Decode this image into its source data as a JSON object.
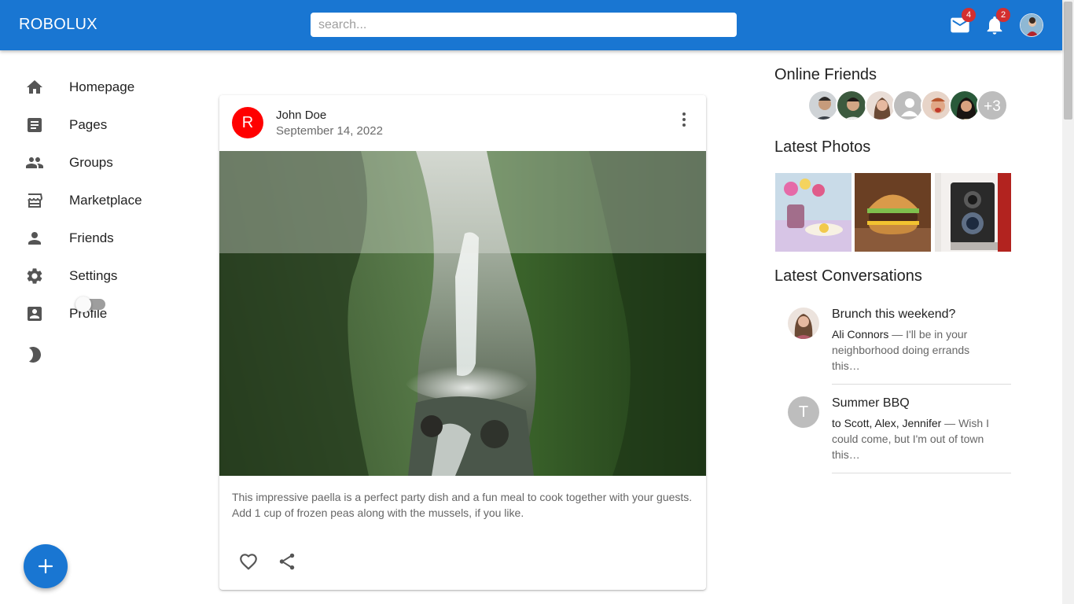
{
  "app": {
    "title": "ROBOLUX",
    "accent": "#1976d2"
  },
  "search": {
    "placeholder": "search...",
    "value": ""
  },
  "topbar": {
    "mail": {
      "icon": "mail-icon",
      "count": "4"
    },
    "notifications": {
      "icon": "bell-icon",
      "count": "2"
    },
    "avatar": {
      "icon": "user-avatar"
    }
  },
  "sidebar": {
    "items": [
      {
        "label": "Homepage",
        "icon": "home-icon"
      },
      {
        "label": "Pages",
        "icon": "article-icon"
      },
      {
        "label": "Groups",
        "icon": "group-icon"
      },
      {
        "label": "Marketplace",
        "icon": "storefront-icon"
      },
      {
        "label": "Friends",
        "icon": "person-icon"
      },
      {
        "label": "Settings",
        "icon": "gear-icon"
      },
      {
        "label": "Profile",
        "icon": "account-box-icon"
      }
    ],
    "dark_mode": {
      "icon": "moon-icon",
      "on": false
    }
  },
  "fab": {
    "icon": "plus-icon",
    "label": "+"
  },
  "post": {
    "avatar_letter": "R",
    "avatar_color": "#ff0000",
    "author": "John Doe",
    "date": "September 14, 2022",
    "text": "This impressive paella is a perfect party dish and a fun meal to cook together with your guests. Add 1 cup of frozen peas along with the mussels, if you like.",
    "actions": [
      "heart-icon",
      "share-icon"
    ]
  },
  "online_friends": {
    "title": "Online Friends",
    "more": "+3"
  },
  "latest_photos": {
    "title": "Latest Photos"
  },
  "latest_conversations": {
    "title": "Latest Conversations",
    "items": [
      {
        "title": "Brunch this weekend?",
        "who": "Ali Connors",
        "preview": " — I'll be in your neighborhood doing errands this…",
        "avatar_letter": ""
      },
      {
        "title": "Summer BBQ",
        "who": "to Scott, Alex, Jennifer",
        "preview": " — Wish I could come, but I'm out of town this…",
        "avatar_letter": "T"
      }
    ]
  }
}
